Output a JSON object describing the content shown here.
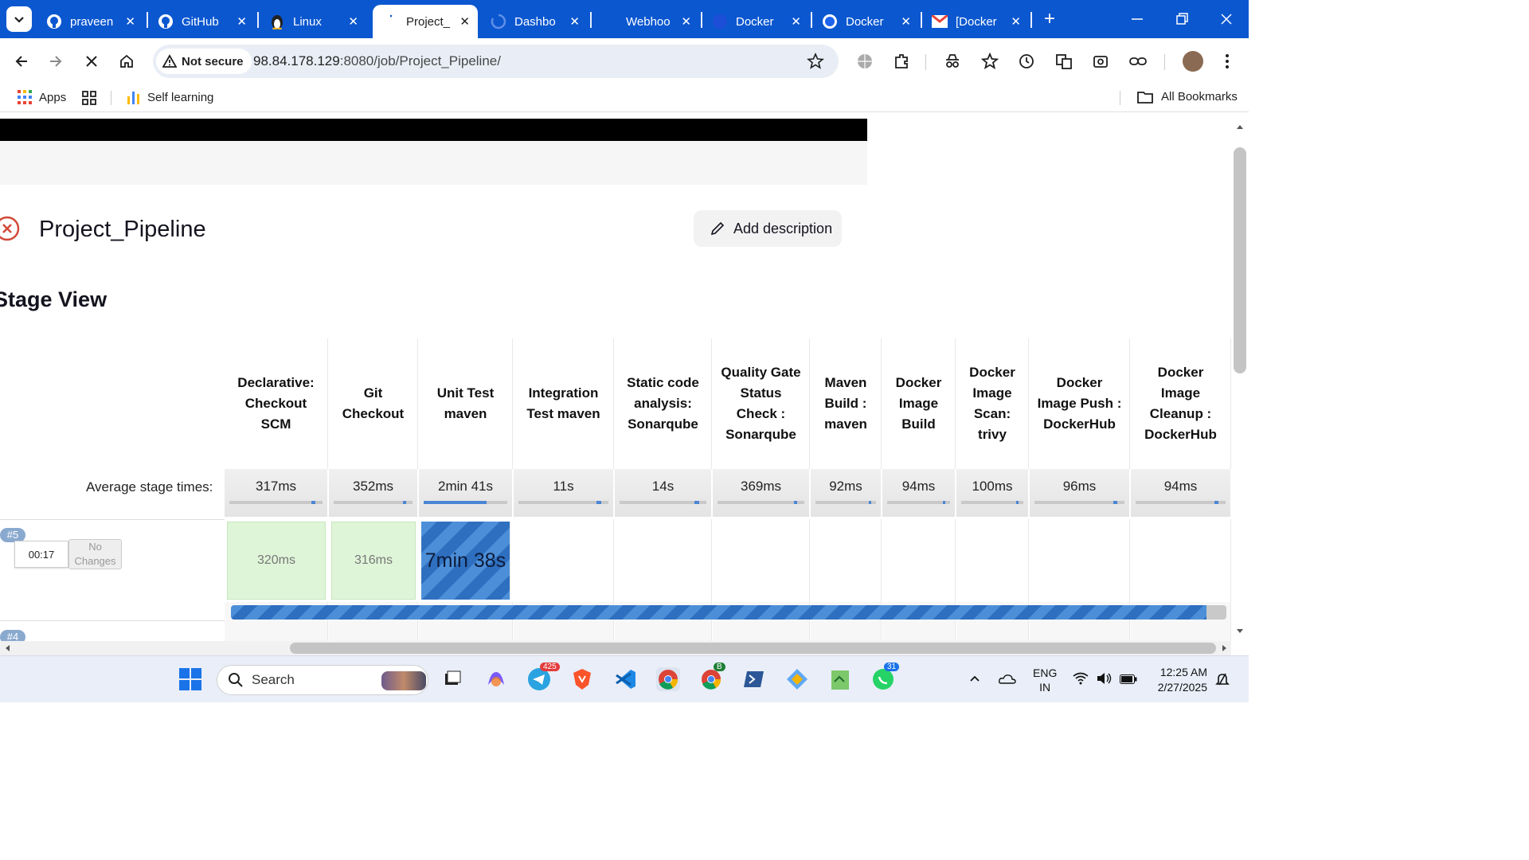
{
  "browser": {
    "tabs": [
      {
        "title": "praveen",
        "icon": "github-icon"
      },
      {
        "title": "GitHub",
        "icon": "github-icon"
      },
      {
        "title": "Linux",
        "icon": "linux-icon"
      },
      {
        "title": "Project_",
        "icon": "loading-icon",
        "active": true
      },
      {
        "title": "Dashbo",
        "icon": "loading-icon"
      },
      {
        "title": "Webhoo",
        "icon": "blank-icon"
      },
      {
        "title": "Docker",
        "icon": "docker-icon"
      },
      {
        "title": "Docker",
        "icon": "docker-icon"
      },
      {
        "title": "[Docker",
        "icon": "gmail-icon"
      }
    ],
    "new_tab": "+",
    "security_label": "Not secure",
    "url_host": "98.84.178.129",
    "url_rest": ":8080/job/Project_Pipeline/",
    "bookmarks": {
      "apps": "Apps",
      "self_learning": "Self learning",
      "all_bookmarks": "All Bookmarks"
    }
  },
  "job": {
    "title": "Project_Pipeline",
    "status": "failed",
    "add_description": "Add description",
    "stage_view_heading": "Stage View",
    "avg_label": "Average stage times:"
  },
  "stages": [
    {
      "name": "Declarative: Checkout SCM",
      "avg": "317ms",
      "avg_share": 0.02
    },
    {
      "name": "Git Checkout",
      "avg": "352ms",
      "avg_share": 0.02
    },
    {
      "name": "Unit Test maven",
      "avg": "2min 41s",
      "avg_share": 0.75
    },
    {
      "name": "Integration Test maven",
      "avg": "11s",
      "avg_share": 0.05
    },
    {
      "name": "Static code analysis: Sonarqube",
      "avg": "14s",
      "avg_share": 0.06
    },
    {
      "name": "Quality Gate Status Check : Sonarqube",
      "avg": "369ms",
      "avg_share": 0.02
    },
    {
      "name": "Maven Build : maven",
      "avg": "92ms",
      "avg_share": 0.01
    },
    {
      "name": "Docker Image Build",
      "avg": "94ms",
      "avg_share": 0.01
    },
    {
      "name": "Docker Image Scan: trivy",
      "avg": "100ms",
      "avg_share": 0.01
    },
    {
      "name": "Docker Image Push : DockerHub",
      "avg": "96ms",
      "avg_share": 0.01
    },
    {
      "name": "Docker Image Cleanup : DockerHub",
      "avg": "94ms",
      "avg_share": 0.01
    }
  ],
  "builds": [
    {
      "number": "#5",
      "time": "00:17",
      "changes": "No Changes",
      "results": [
        "320ms",
        "316ms",
        "7min 38s"
      ],
      "progress": 0.98
    },
    {
      "number": "#4"
    }
  ],
  "taskbar": {
    "search_placeholder": "Search",
    "telegram_badge": "425",
    "whatsapp_badge": "31",
    "chrome2_badge": "B",
    "lang_top": "ENG",
    "lang_bottom": "IN",
    "time": "12:25 AM",
    "date": "2/27/2025"
  },
  "colors": {
    "tabstrip": "#0b57d0",
    "success_cell": "#dff5d8",
    "running_stripe": "#4c8fd8",
    "fail_icon": "#d24939"
  }
}
